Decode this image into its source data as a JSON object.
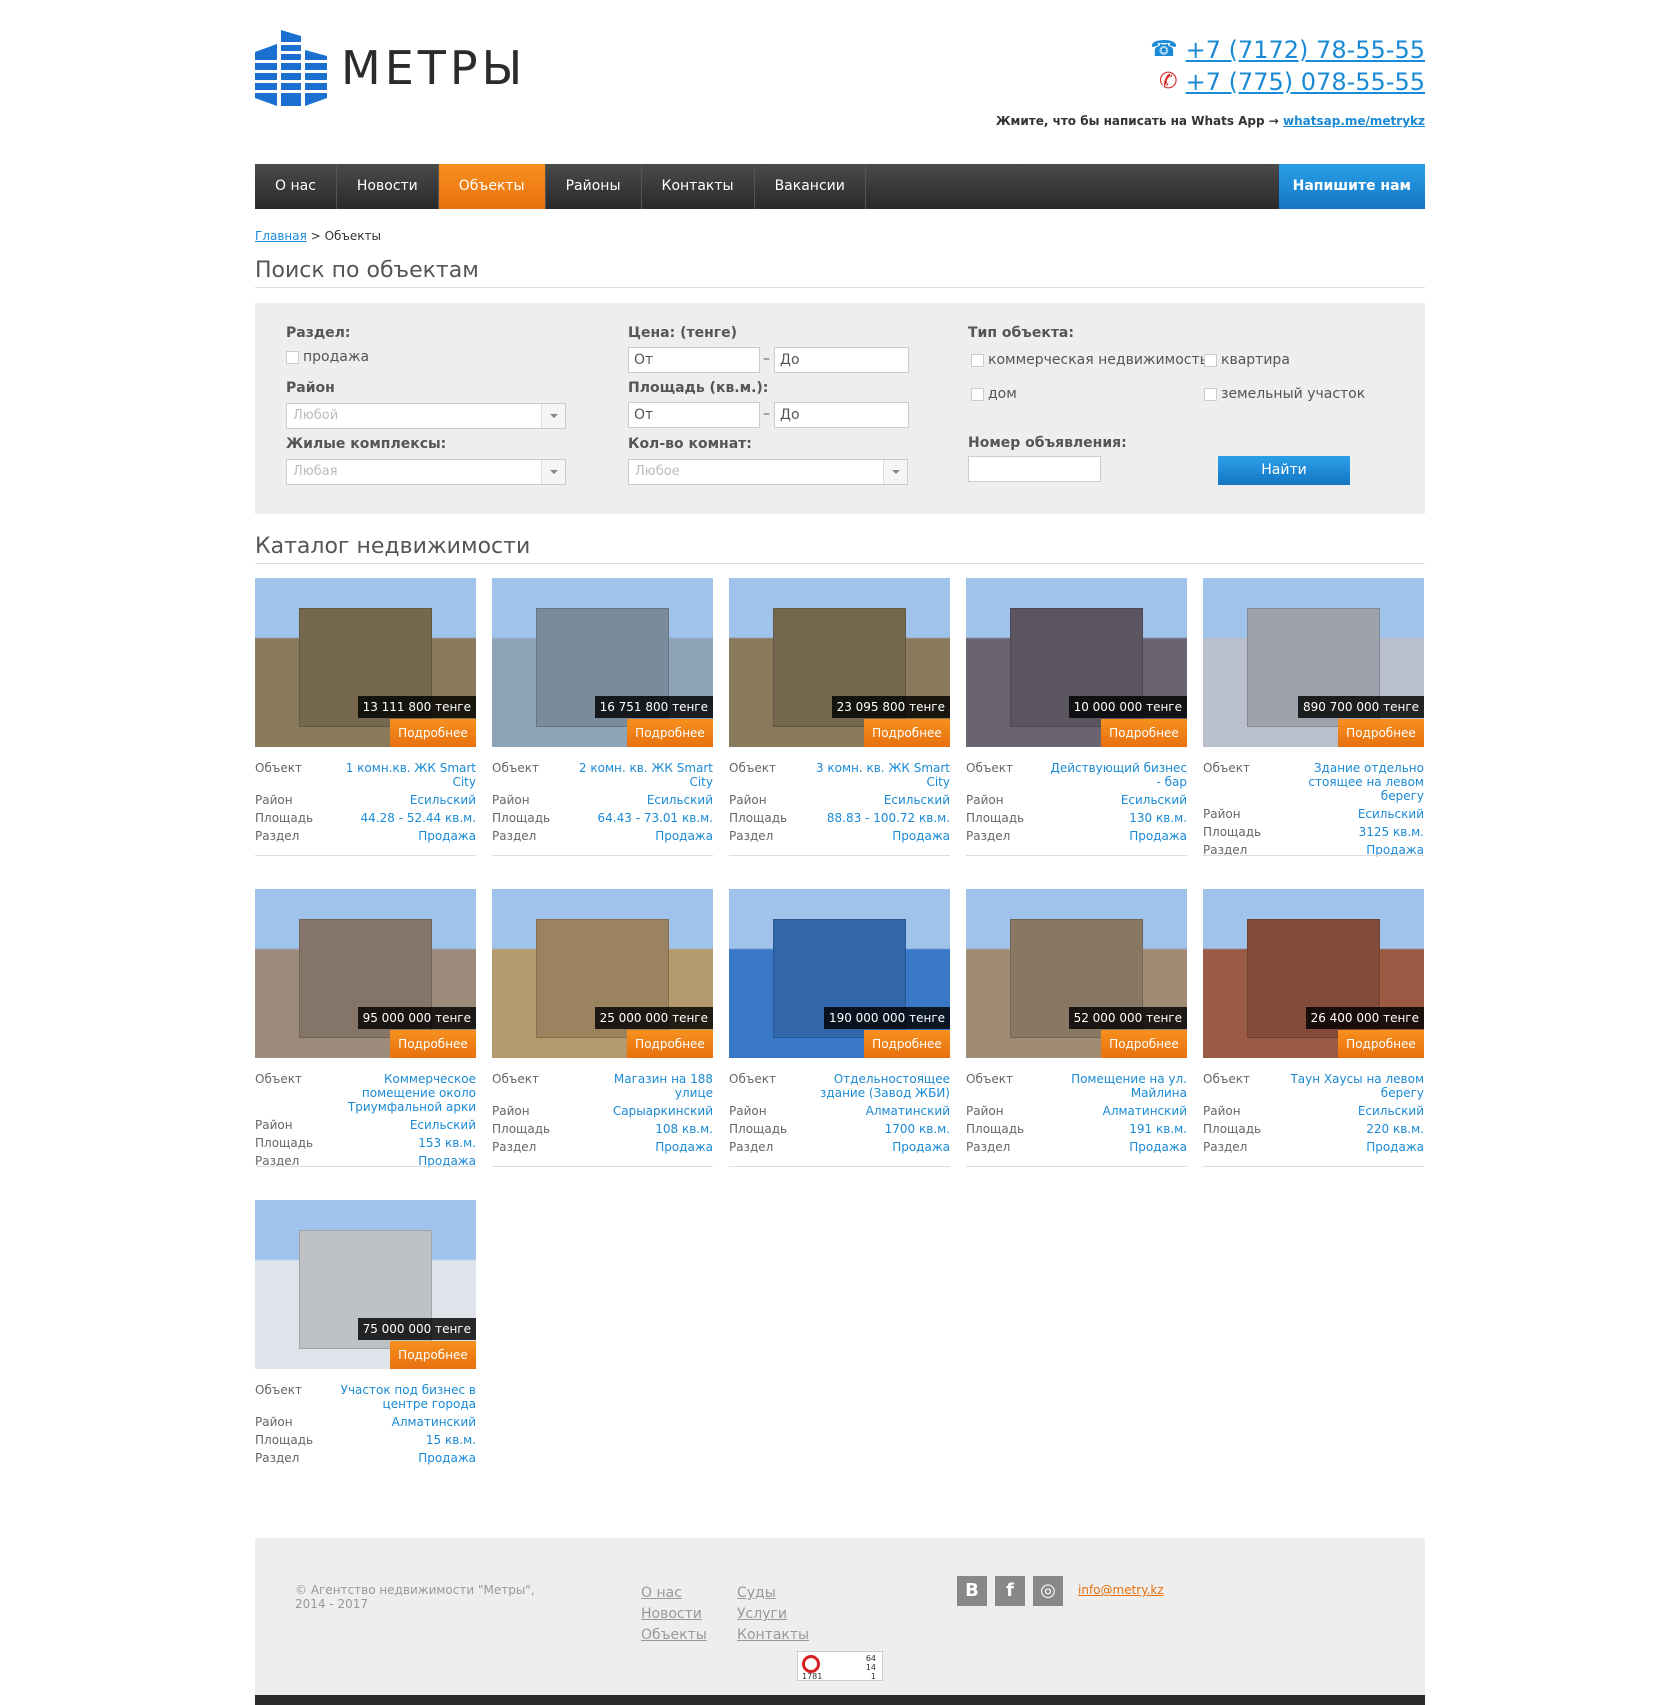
{
  "header": {
    "logo_text": "МЕТРЫ",
    "phone1": "+7 (7172) 78-55-55",
    "phone2": "+7 (775) 078-55-55",
    "whats_text": "Жмите, что бы написать на Whats App →",
    "whats_link": "whatsap.me/metrykz"
  },
  "nav": {
    "items": [
      "О нас",
      "Новости",
      "Объекты",
      "Районы",
      "Контакты",
      "Вакансии"
    ],
    "active": "Объекты",
    "cta": "Напишите нам"
  },
  "breadcrumb": {
    "home": "Главная",
    "sep": ">",
    "current": "Объекты"
  },
  "search": {
    "title": "Поиск по объектам",
    "section_label": "Раздел:",
    "section_option": "продажа",
    "district_label": "Район",
    "district_value": "Любой",
    "complex_label": "Жилые комплексы:",
    "complex_value": "Любая",
    "price_label": "Цена: (тенге)",
    "area_label": "Площадь (кв.м.):",
    "from_placeholder": "От",
    "to_placeholder": "До",
    "rooms_label": "Кол-во комнат:",
    "rooms_value": "Любое",
    "type_label": "Тип объекта:",
    "type_options": [
      "коммерческая недвижимость",
      "квартира",
      "дом",
      "земельный участок"
    ],
    "number_label": "Номер объявления:",
    "find_button": "Найти"
  },
  "catalog": {
    "title": "Каталог недвижимости",
    "labels": {
      "object": "Объект",
      "district": "Район",
      "area": "Площадь",
      "section": "Раздел"
    },
    "more_label": "Подробнее",
    "items": [
      {
        "price": "13 111 800 тенге",
        "object": "1 комн.кв. ЖК Smart City",
        "district": "Есильский",
        "area": "44.28 - 52.44 кв.м.",
        "section": "Продажа",
        "color": "#8a7a5c"
      },
      {
        "price": "16 751 800 тенге",
        "object": "2 комн. кв. ЖК Smart City",
        "district": "Есильский",
        "area": "64.43 - 73.01 кв.м.",
        "section": "Продажа",
        "color": "#8fa3b8"
      },
      {
        "price": "23 095 800 тенге",
        "object": "3 комн. кв. ЖК Smart City",
        "district": "Есильский",
        "area": "88.83 - 100.72 кв.м.",
        "section": "Продажа",
        "color": "#8a7a5c"
      },
      {
        "price": "10 000 000 тенге",
        "object": "Действующий бизнес - бар",
        "district": "Есильский",
        "area": "130 кв.м.",
        "section": "Продажа",
        "color": "#6b6470"
      },
      {
        "price": "890 700 000 тенге",
        "object": "Здание отдельно стоящее на левом берегу",
        "district": "Есильский",
        "area": "3125 кв.м.",
        "section": "Продажа",
        "color": "#b9bfcc"
      },
      {
        "price": "95 000 000 тенге",
        "object": "Коммерческое помещение около Триумфальной арки",
        "district": "Есильский",
        "area": "153 кв.м.",
        "section": "Продажа",
        "color": "#9c8a7a"
      },
      {
        "price": "25 000 000 тенге",
        "object": "Магазин на 188 улице",
        "district": "Сарыаркинский",
        "area": "108 кв.м.",
        "section": "Продажа",
        "color": "#b59a6e"
      },
      {
        "price": "190 000 000 тенге",
        "object": "Отдельностоящее здание (Завод ЖБИ)",
        "district": "Алматинский",
        "area": "1700 кв.м.",
        "section": "Продажа",
        "color": "#3a78c8"
      },
      {
        "price": "52 000 000 тенге",
        "object": "Помещение на ул. Майлина",
        "district": "Алматинский",
        "area": "191 кв.м.",
        "section": "Продажа",
        "color": "#a08c74"
      },
      {
        "price": "26 400 000 тенге",
        "object": "Таун Хаусы на левом берегу",
        "district": "Есильский",
        "area": "220 кв.м.",
        "section": "Продажа",
        "color": "#9a5a44"
      },
      {
        "price": "75 000 000 тенге",
        "object": "Участок под бизнес в центре города",
        "district": "Алматинский",
        "area": "15 кв.м.",
        "section": "Продажа",
        "color": "#dfe4ea"
      }
    ]
  },
  "footer": {
    "copyright": "© Агентство недвижимости \"Метры\", 2014 - 2017",
    "links_col1": [
      "О нас",
      "Новости",
      "Объекты"
    ],
    "links_col2": [
      "Суды",
      "Услуги",
      "Контакты"
    ],
    "social": [
      "В",
      "f",
      "◎"
    ],
    "email": "info@metry.kz",
    "counter": [
      "64",
      "14",
      "1781",
      "1"
    ]
  },
  "colors": {
    "accent_blue": "#1a8ad6",
    "accent_orange": "#e8710f",
    "nav_dark": "#2a2a2a"
  }
}
